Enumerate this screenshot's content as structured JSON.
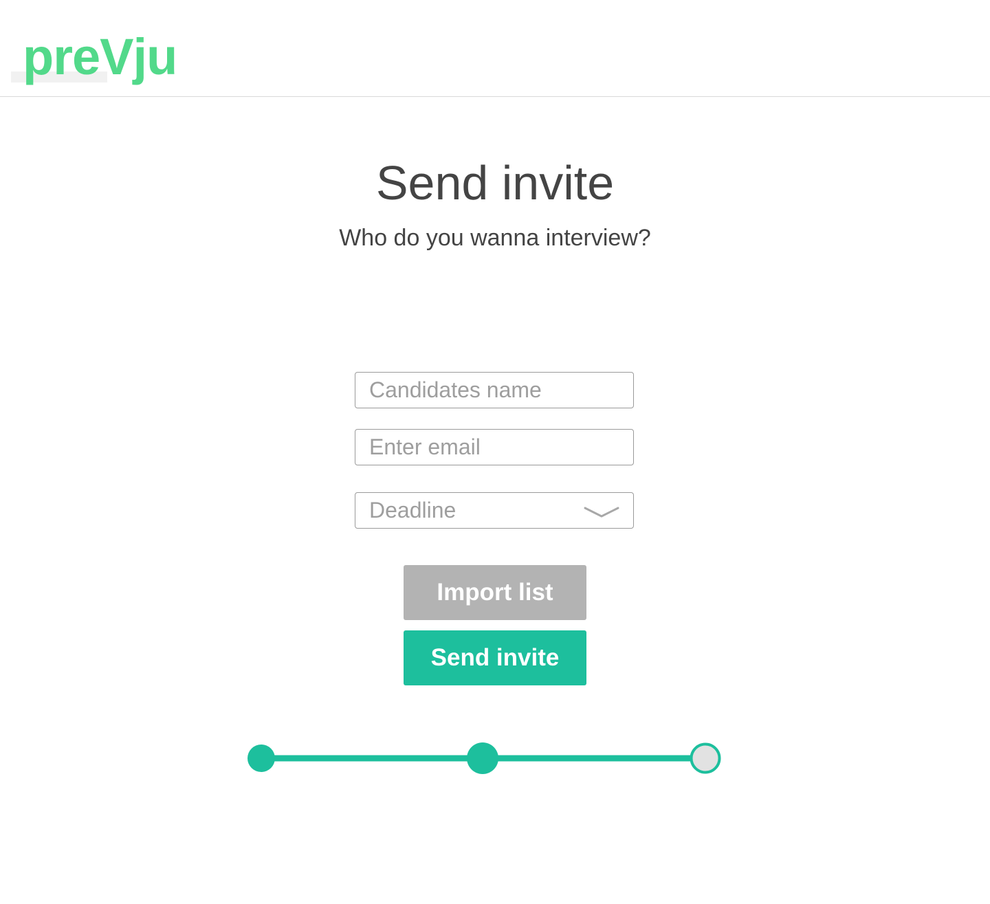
{
  "header": {
    "logo_text": "preVju"
  },
  "main": {
    "title": "Send invite",
    "subtitle": "Who do you wanna interview?"
  },
  "form": {
    "name_placeholder": "Candidates name",
    "email_placeholder": "Enter email",
    "deadline_placeholder": "Deadline",
    "import_label": "Import list",
    "send_label": "Send invite"
  },
  "progress": {
    "total_steps": 3,
    "completed_steps": 2
  },
  "colors": {
    "brand_green": "#52d98a",
    "accent_teal": "#1dbf9d",
    "disabled_gray": "#b3b3b3",
    "text_dark": "#444444"
  }
}
